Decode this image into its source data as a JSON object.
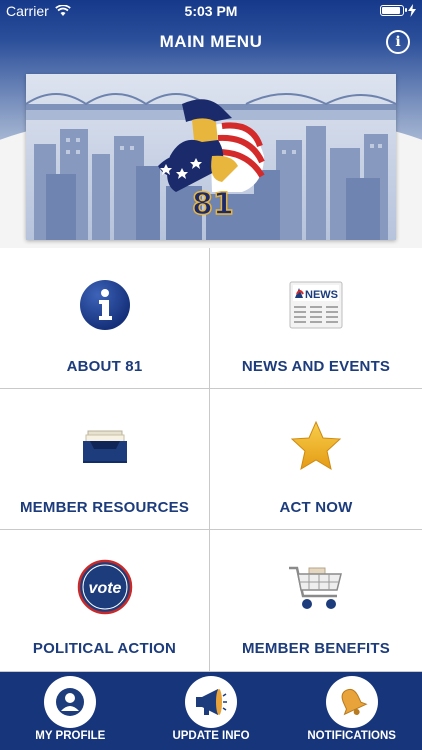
{
  "status_bar": {
    "carrier": "Carrier",
    "time": "5:03 PM",
    "battery_level": 0.9
  },
  "header": {
    "title": "MAIN MENU",
    "info_icon": "info-icon",
    "banner_number": "81"
  },
  "tiles": [
    {
      "label": "ABOUT 81",
      "icon": "info-circle-icon"
    },
    {
      "label": "NEWS AND EVENTS",
      "icon": "newspaper-icon",
      "icon_text": "NEWS"
    },
    {
      "label": "MEMBER RESOURCES",
      "icon": "inbox-tray-icon"
    },
    {
      "label": "ACT NOW",
      "icon": "star-icon"
    },
    {
      "label": "POLITICAL ACTION",
      "icon": "vote-badge-icon",
      "icon_text": "vote"
    },
    {
      "label": "MEMBER BENEFITS",
      "icon": "shopping-cart-icon"
    }
  ],
  "bottom_nav": [
    {
      "label": "MY PROFILE",
      "icon": "user-icon"
    },
    {
      "label": "UPDATE INFO",
      "icon": "megaphone-icon"
    },
    {
      "label": "NOTIFICATIONS",
      "icon": "bell-icon"
    }
  ],
  "colors": {
    "primary": "#17357a",
    "label": "#1d3c7c",
    "star": "#f2b51e",
    "bell": "#e8a33a"
  }
}
